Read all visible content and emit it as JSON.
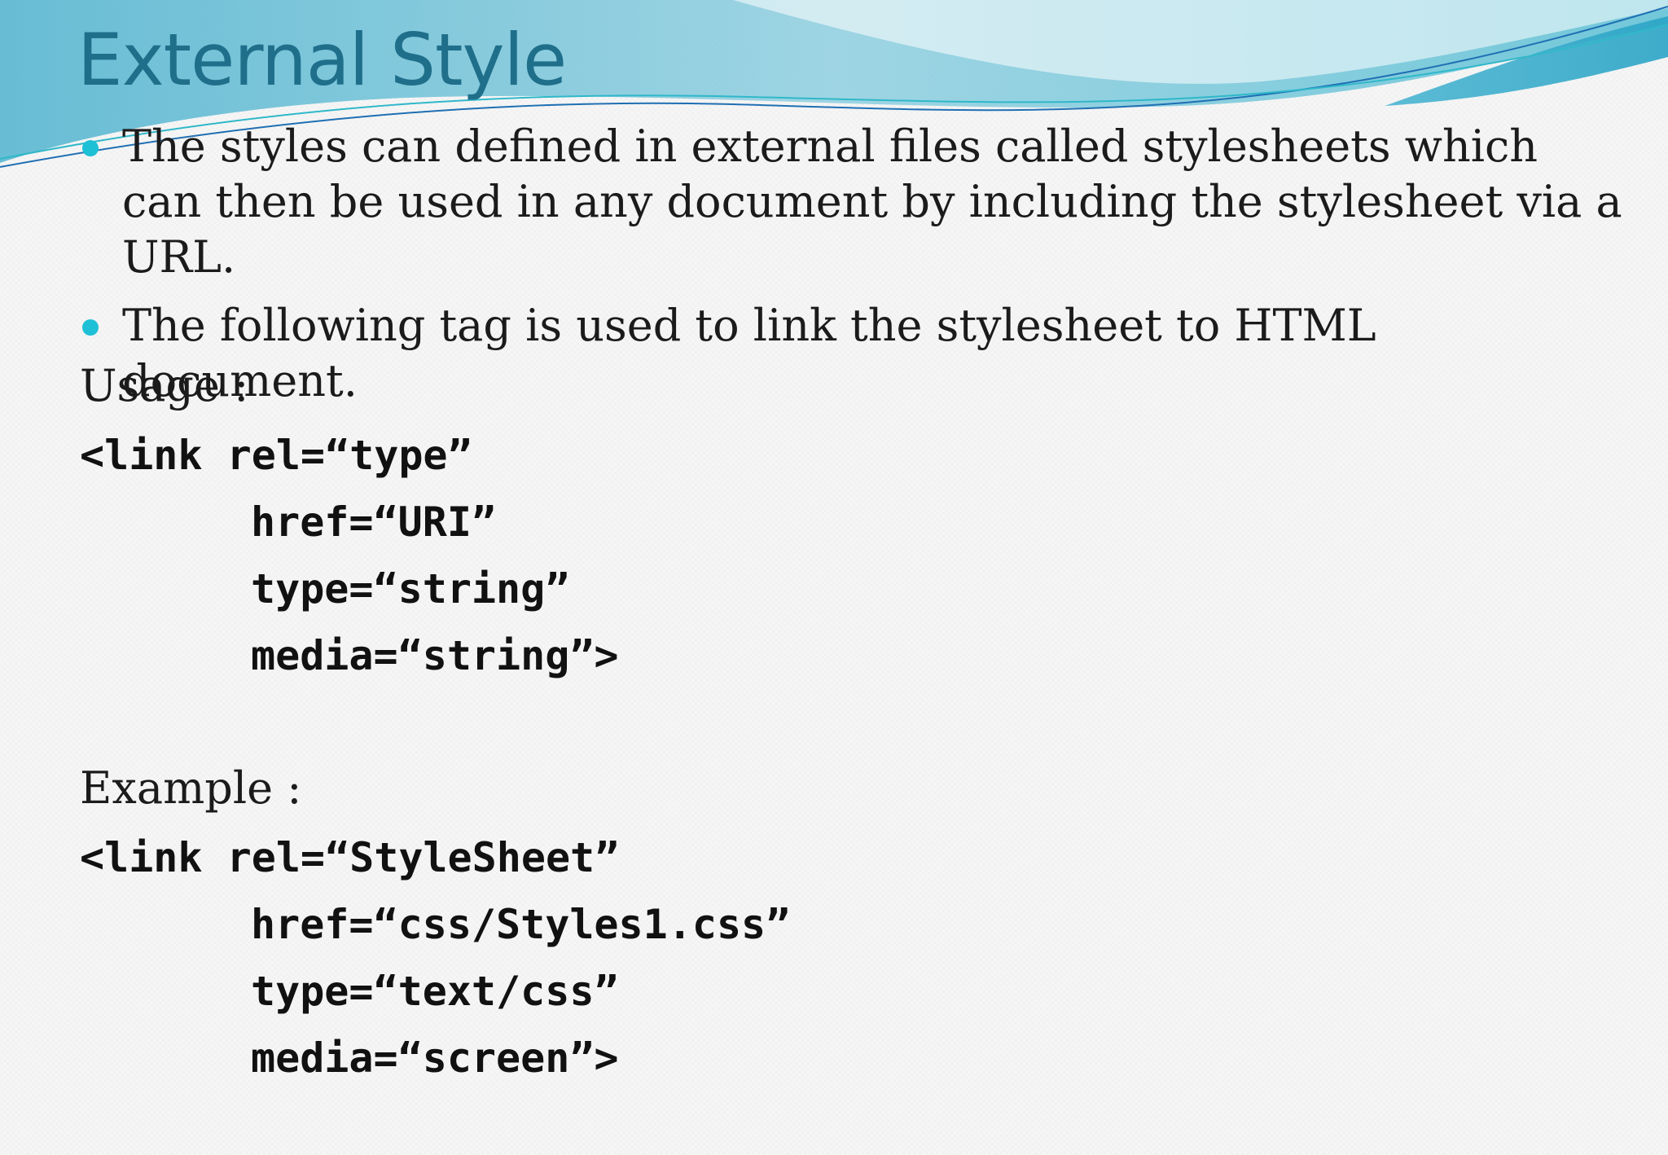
{
  "slide": {
    "title": "External Style",
    "bullets": [
      "The styles can defined in external files called stylesheets which can then be used in any document by including the stylesheet via a URL.",
      "The following tag is used to link the stylesheet to HTML document."
    ],
    "usage": {
      "label": "Usage :",
      "lines": [
        "<link rel=“type”",
        "href=“URI”",
        "type=“string”",
        "media=“string”>"
      ]
    },
    "example": {
      "label": "Example :",
      "lines": [
        "<link rel=“StyleSheet”",
        "href=“css/Styles1.css”",
        "type=“text/css”",
        "media=“screen”>"
      ]
    }
  },
  "colors": {
    "title": "#1f6f8b",
    "bullet": "#1ec0d6",
    "text": "#1b1b1b"
  }
}
